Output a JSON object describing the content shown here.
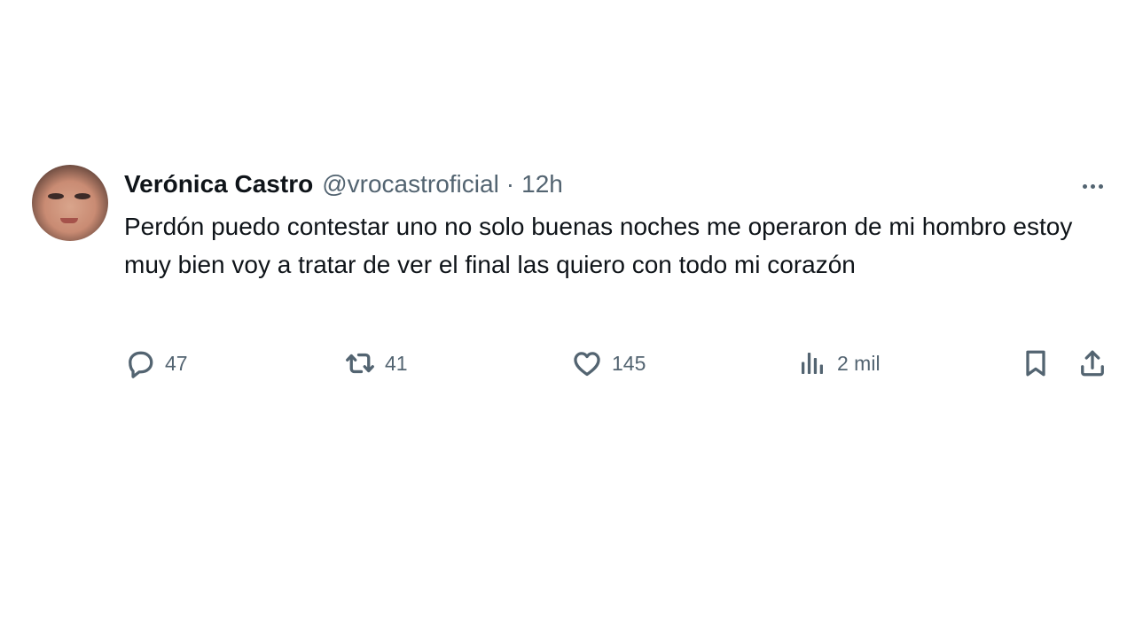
{
  "tweet": {
    "author": {
      "name": "Verónica Castro",
      "handle": "@vrocastroficial"
    },
    "separator": "·",
    "time": "12h",
    "text": "Perdón puedo contestar uno no solo buenas noches me operaron de mi hombro estoy muy bien voy a tratar de ver el final las quiero con todo mi corazón",
    "more_icon": "more-horizontal-icon",
    "actions": {
      "reply": {
        "icon": "reply-icon",
        "count": "47"
      },
      "retweet": {
        "icon": "retweet-icon",
        "count": "41"
      },
      "like": {
        "icon": "heart-icon",
        "count": "145"
      },
      "views": {
        "icon": "views-icon",
        "count": "2 mil"
      },
      "bookmark": {
        "icon": "bookmark-icon"
      },
      "share": {
        "icon": "share-icon"
      }
    }
  },
  "colors": {
    "text": "#0f1419",
    "secondary": "#536471",
    "background": "#ffffff"
  }
}
